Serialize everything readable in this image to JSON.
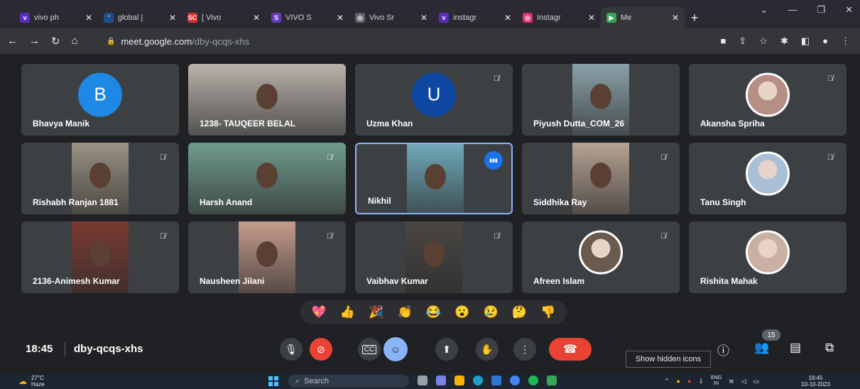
{
  "browser": {
    "tabs": [
      {
        "title": "vivo ph",
        "color": "#5b2dbd",
        "glyph": "v"
      },
      {
        "title": "global |",
        "color": "#1f4e8c",
        "glyph": "'"
      },
      {
        "title": "[ Vivo",
        "color": "#d32f2f",
        "glyph": "SC"
      },
      {
        "title": "VIVO S",
        "color": "#6a3cbc",
        "glyph": "S"
      },
      {
        "title": "Vivo Sr",
        "color": "#5f6368",
        "glyph": "◎"
      },
      {
        "title": "instagr",
        "color": "#5b2dbd",
        "glyph": "v"
      },
      {
        "title": "Instagr",
        "color": "#e1306c",
        "glyph": "◎"
      },
      {
        "title": "Me",
        "color": "#34a853",
        "glyph": "▶"
      }
    ],
    "url_host": "meet.google.com",
    "url_path": "/dby-qcqs-xhs"
  },
  "participants": [
    {
      "name": "Bhavya Manik",
      "initial": "B",
      "avatar_color": "#1e88e5",
      "kind": "avatar",
      "muted": false
    },
    {
      "name": "1238- TAUQEER BELAL",
      "kind": "video",
      "video_color": "#b9b2ab",
      "muted": false
    },
    {
      "name": "Uzma Khan",
      "initial": "U",
      "avatar_color": "#0d47a1",
      "kind": "avatar",
      "muted": true
    },
    {
      "name": "Piyush Dutta_COM_26",
      "kind": "video",
      "video_color": "#8aa1a8",
      "muted": false
    },
    {
      "name": "Akansha Spriha",
      "kind": "photo",
      "photo_color": "#b58e84",
      "muted": true
    },
    {
      "name": "Rishabh Ranjan 1881",
      "kind": "video",
      "video_color": "#9a9285",
      "muted": true
    },
    {
      "name": "Harsh Anand",
      "kind": "video",
      "video_color": "#6f9b8c",
      "muted": true
    },
    {
      "name": "Nikhil",
      "kind": "video",
      "video_color": "#6fa8b8",
      "muted": false,
      "speaking": true
    },
    {
      "name": "Siddhika Ray",
      "kind": "video",
      "video_color": "#b7a394",
      "muted": true
    },
    {
      "name": "Tanu Singh",
      "kind": "photo",
      "photo_color": "#a8bfd6",
      "muted": true
    },
    {
      "name": "2136-Animesh Kumar",
      "kind": "video",
      "video_color": "#7a3b32",
      "muted": true
    },
    {
      "name": "Nausheen Jilani",
      "kind": "video",
      "video_color": "#c59c8c",
      "muted": true
    },
    {
      "name": "Vaibhav Kumar",
      "kind": "video",
      "video_color": "#4a4744",
      "muted": true
    },
    {
      "name": "Afreen Islam",
      "kind": "photo",
      "photo_color": "#6b5a4e",
      "muted": true
    },
    {
      "name": "Rishita Mahak",
      "kind": "photo",
      "photo_color": "#c9b0a3",
      "muted": false
    }
  ],
  "reactions": [
    "💖",
    "👍",
    "🎉",
    "👏",
    "😂",
    "😮",
    "😢",
    "🤔",
    "👎"
  ],
  "meeting": {
    "time": "18:45",
    "code": "dby-qcqs-xhs",
    "people_count": "15",
    "tooltip": "Show hidden icons"
  },
  "taskbar": {
    "temp": "27°C",
    "weather": "Haze",
    "search": "Search",
    "lang": "ENG",
    "region": "IN",
    "clock_time": "18:45",
    "clock_date": "10-10-2023"
  }
}
